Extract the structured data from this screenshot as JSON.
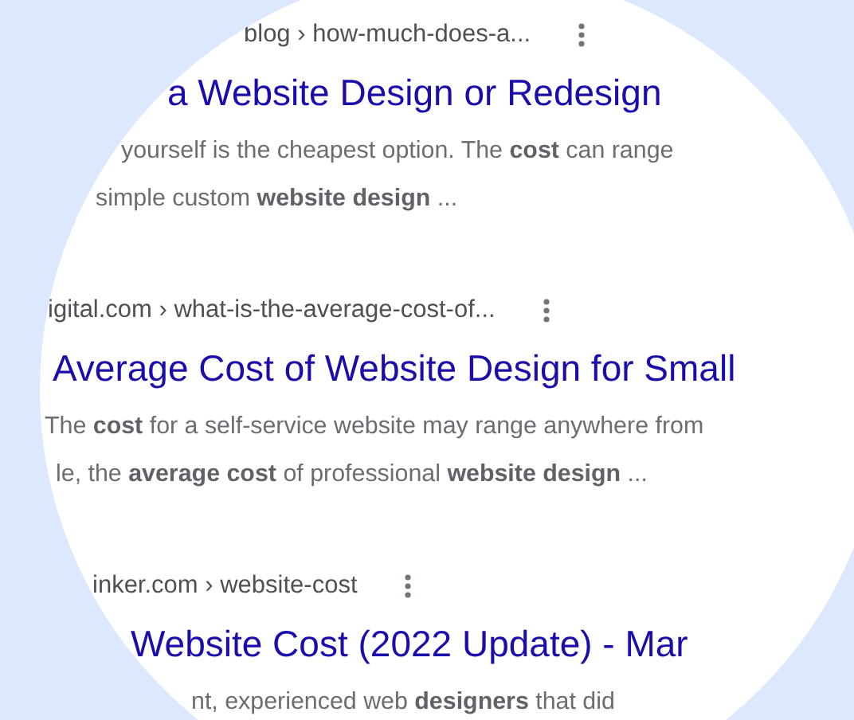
{
  "results": [
    {
      "url": "blog › how-much-does-a...",
      "title": "a Website Design or Redesign",
      "snippet": [
        "yourself is the cheapest option. The **cost** can range",
        "simple custom **website design** ..."
      ]
    },
    {
      "url": "igital.com › what-is-the-average-cost-of...",
      "title": "Average Cost of Website Design for Small",
      "snippet": [
        "The **cost** for a self-service website may range anywhere from",
        "le, the **average cost** of professional **website design** ..."
      ]
    },
    {
      "url": "inker.com › website-cost",
      "title": "Website Cost (2022 Update) - Mar",
      "snippet": [
        "nt, experienced web **designers** that did"
      ]
    }
  ]
}
